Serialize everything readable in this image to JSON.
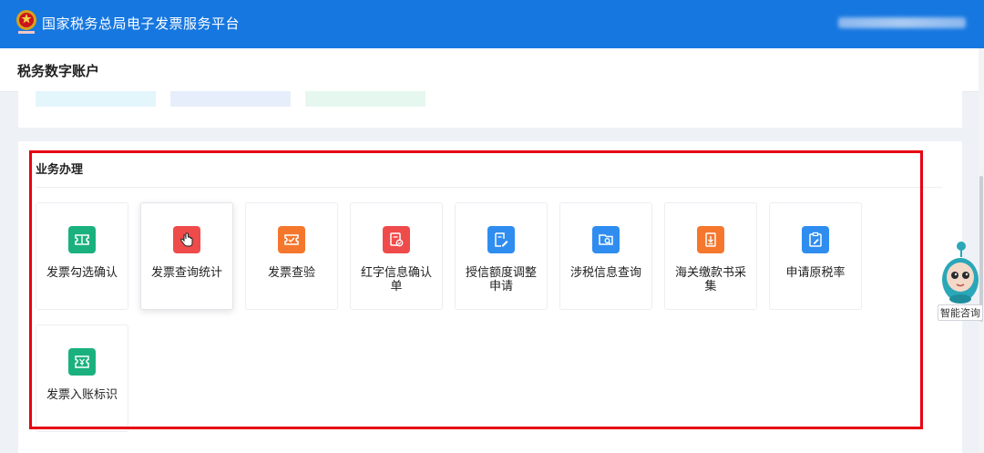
{
  "header": {
    "platform_title": "国家税务总局电子发票服务平台"
  },
  "subheader": {
    "title": "税务数字账户"
  },
  "section": {
    "title": "业务办理"
  },
  "services": [
    {
      "label": "发票勾选确认",
      "icon": "ticket-icon",
      "color": "#1bb17f"
    },
    {
      "label": "发票查询统计",
      "icon": "hand-pointer-icon",
      "color": "#ef4b4b"
    },
    {
      "label": "发票查验",
      "icon": "ticket-check-icon",
      "color": "#f5772d"
    },
    {
      "label": "红字信息确认单",
      "icon": "document-check-icon",
      "color": "#ef4b4b"
    },
    {
      "label": "授信额度调整申请",
      "icon": "edit-document-icon",
      "color": "#2f8df0"
    },
    {
      "label": "涉税信息查询",
      "icon": "search-folder-icon",
      "color": "#2f8df0"
    },
    {
      "label": "海关缴款书采集",
      "icon": "download-document-icon",
      "color": "#f5772d"
    },
    {
      "label": "申请原税率",
      "icon": "clipboard-edit-icon",
      "color": "#2f8df0"
    },
    {
      "label": "发票入账标识",
      "icon": "ticket-mark-icon",
      "color": "#1bb17f"
    }
  ],
  "assistant": {
    "label": "智能咨询"
  }
}
